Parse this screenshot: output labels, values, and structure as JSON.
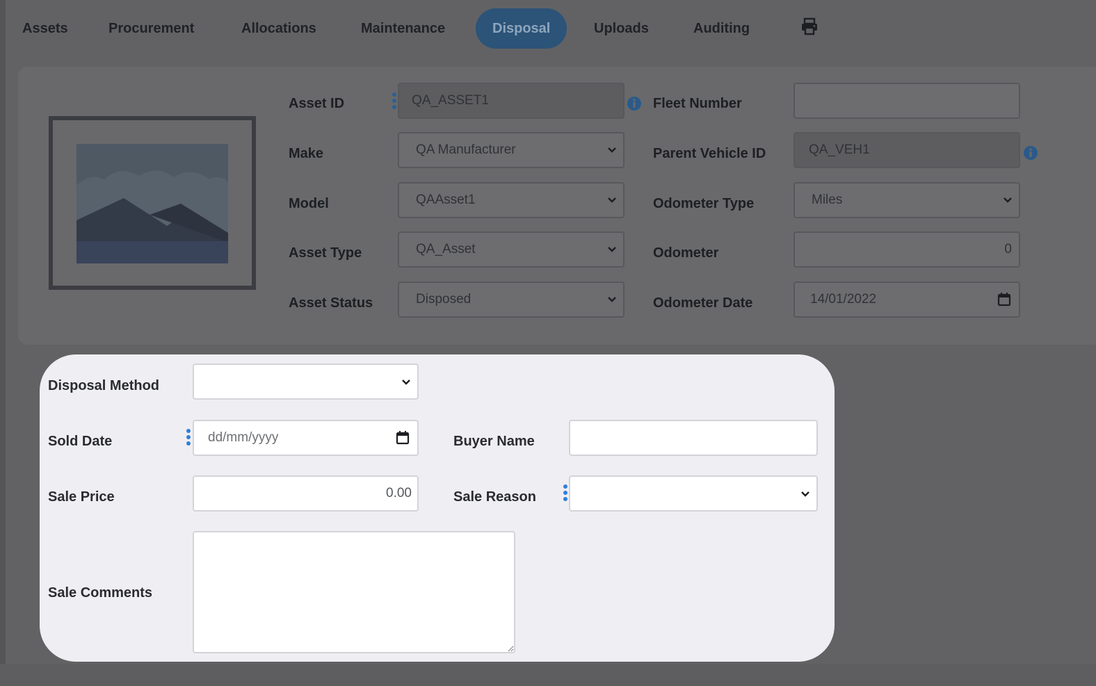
{
  "tabs": [
    {
      "label": "Assets",
      "active": false
    },
    {
      "label": "Procurement",
      "active": false
    },
    {
      "label": "Allocations",
      "active": false
    },
    {
      "label": "Maintenance",
      "active": false
    },
    {
      "label": "Disposal",
      "active": true
    },
    {
      "label": "Uploads",
      "active": false
    },
    {
      "label": "Auditing",
      "active": false
    }
  ],
  "print_icon": "printer-icon",
  "asset": {
    "asset_id_label": "Asset ID",
    "asset_id_value": "QA_ASSET1",
    "make_label": "Make",
    "make_value": "QA Manufacturer",
    "model_label": "Model",
    "model_value": "QAAsset1",
    "asset_type_label": "Asset Type",
    "asset_type_value": "QA_Asset",
    "asset_status_label": "Asset Status",
    "asset_status_value": "Disposed",
    "fleet_number_label": "Fleet Number",
    "fleet_number_value": "",
    "parent_vehicle_label": "Parent Vehicle ID",
    "parent_vehicle_value": "QA_VEH1",
    "odometer_type_label": "Odometer Type",
    "odometer_type_value": "Miles",
    "odometer_label": "Odometer",
    "odometer_value": "0",
    "odometer_date_label": "Odometer Date",
    "odometer_date_value": "14/01/2022"
  },
  "disposal": {
    "method_label": "Disposal Method",
    "method_value": "",
    "sold_date_label": "Sold Date",
    "sold_date_placeholder": "dd/mm/yyyy",
    "buyer_name_label": "Buyer Name",
    "buyer_name_value": "",
    "sale_price_label": "Sale Price",
    "sale_price_value": "0.00",
    "sale_reason_label": "Sale Reason",
    "sale_reason_value": "",
    "sale_comments_label": "Sale Comments",
    "sale_comments_value": ""
  },
  "colors": {
    "active_tab": "#2c5378",
    "info_icon": "#2f7fd6",
    "card_background": "#efeef3"
  }
}
